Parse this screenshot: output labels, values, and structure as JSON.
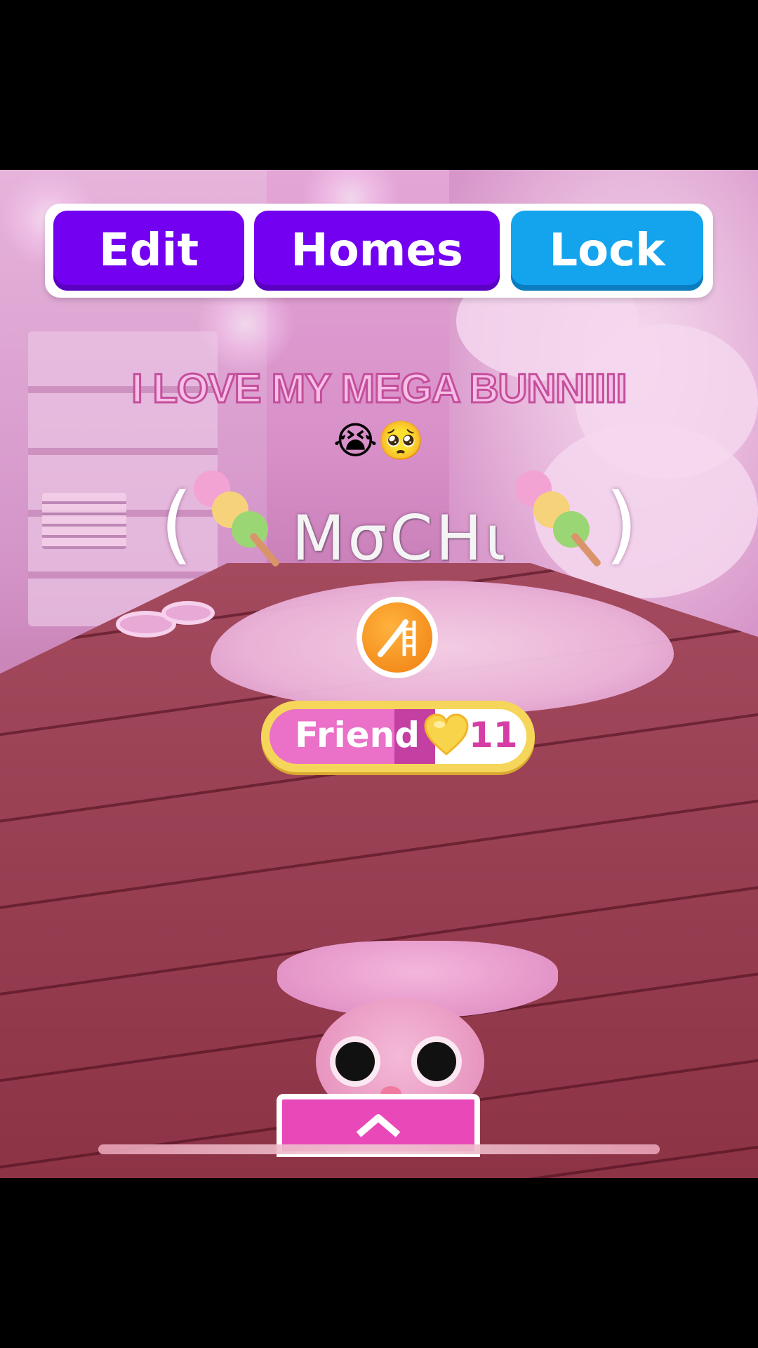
{
  "toolbar": {
    "edit_label": "Edit",
    "homes_label": "Homes",
    "lock_label": "Lock",
    "colors": {
      "edit": "#7300f0",
      "homes": "#7300f0",
      "lock": "#14a4ee"
    }
  },
  "caption": {
    "text": "I LOVE MY MEGA BUNNIIII",
    "emojis": "😭🥺"
  },
  "pet": {
    "name": "MσCHι",
    "open_paren": "(",
    "close_paren": ")",
    "decoration_icon": "dango-icon"
  },
  "action_icon": "slide-icon",
  "friend_badge": {
    "label": "Friend",
    "level": "11",
    "icon": "heart-icon"
  },
  "bottom_tab": {
    "icon": "chevron-up-icon"
  }
}
